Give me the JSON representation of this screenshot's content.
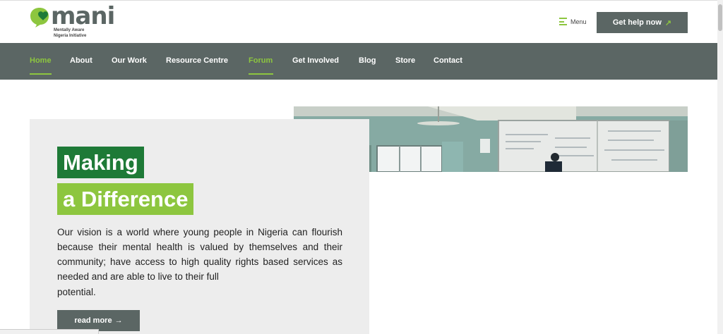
{
  "header": {
    "logo": {
      "word": "mani",
      "tagline_1": "Mentally Aware",
      "tagline_2": "Nigeria Initiative",
      "brand_green": "#8dc63f",
      "brand_dark_green": "#1e7a37"
    },
    "menu_label": "Menu",
    "help_button": {
      "label": "Get help now",
      "arrow": "↗"
    }
  },
  "nav": {
    "items": [
      {
        "label": "Home",
        "active": true
      },
      {
        "label": "About",
        "active": false
      },
      {
        "label": "Our Work",
        "active": false
      },
      {
        "label": "Resource Centre",
        "active": false
      },
      {
        "label": "Forum",
        "active": true
      },
      {
        "label": "Get Involved",
        "active": false
      },
      {
        "label": "Blog",
        "active": false
      },
      {
        "label": "Store",
        "active": false
      },
      {
        "label": "Contact",
        "active": false
      }
    ],
    "background": "#5b6664"
  },
  "hero": {
    "title_line_1": "Making",
    "title_line_2": "a Difference",
    "vision_text": "Our vision is a world where young people in Nigeria can flourish because their mental health is valued by themselves and their community; have access to high quality rights based services as needed and are able to live to their full",
    "vision_last": "potential.",
    "read_more": {
      "label": "read more",
      "arrow": "→"
    },
    "photo_icon": "classroom-photo"
  }
}
